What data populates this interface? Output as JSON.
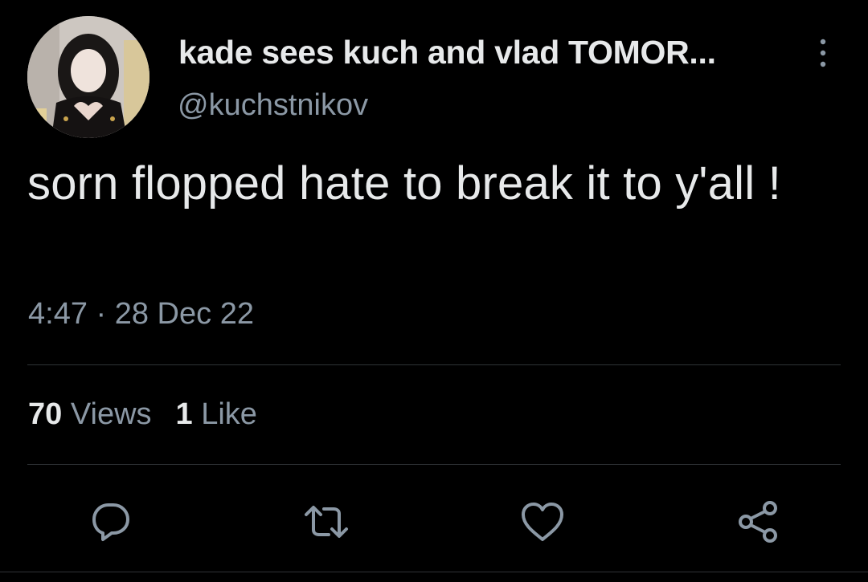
{
  "tweet": {
    "display_name": "kade sees kuch and vlad TOMOR...",
    "handle": "@kuchstnikov",
    "text": "sorn flopped hate to break it to y'all !",
    "timestamp": "4:47 · 28 Dec 22"
  },
  "stats": {
    "views_count": "70",
    "views_label": "Views",
    "likes_count": "1",
    "likes_label": "Like"
  },
  "icons": {
    "more": "more-vertical-icon",
    "reply": "reply-icon",
    "retweet": "retweet-icon",
    "like": "heart-icon",
    "share": "share-icon"
  },
  "colors": {
    "background": "#000000",
    "primary_text": "#e7e9ea",
    "secondary_text": "#8b98a5",
    "divider": "#2f3336"
  }
}
